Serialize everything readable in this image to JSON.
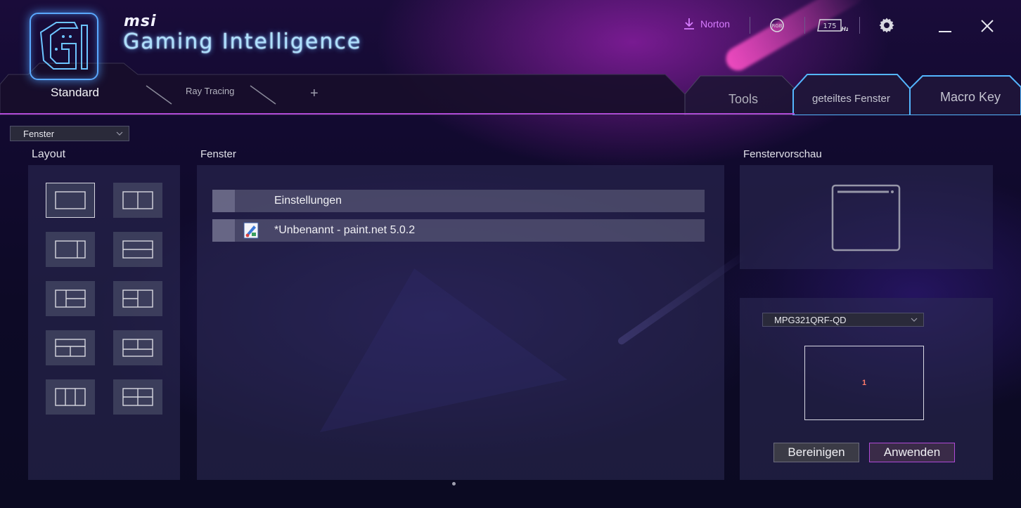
{
  "brand": {
    "vendor": "msi",
    "product": "Gaming Intelligence"
  },
  "header": {
    "norton_label": "Norton",
    "rgb_label": "RGB",
    "refresh_rate": "175",
    "refresh_unit": "Hz"
  },
  "tabs_left": [
    {
      "label": "Standard",
      "active": true
    },
    {
      "label": "Ray Tracing",
      "active": false
    },
    {
      "label": "+",
      "active": false
    }
  ],
  "tabs_right": [
    {
      "label": "Tools",
      "active": false
    },
    {
      "label": "geteiltes Fenster",
      "active": true
    },
    {
      "label": "Macro Key",
      "active": false
    }
  ],
  "mode_dropdown": {
    "value": "Fenster"
  },
  "sections": {
    "layout": "Layout",
    "windows": "Fenster",
    "preview": "Fenstervorschau"
  },
  "layouts": [
    {
      "id": "single",
      "selected": true
    },
    {
      "id": "two-columns",
      "selected": false
    },
    {
      "id": "wide-left-narrow-right",
      "selected": false
    },
    {
      "id": "two-rows",
      "selected": false
    },
    {
      "id": "left-column-plus-two-right",
      "selected": false
    },
    {
      "id": "two-columns-right-split",
      "selected": false
    },
    {
      "id": "top-row-plus-two-bottom",
      "selected": false
    },
    {
      "id": "two-top-plus-bottom-row",
      "selected": false
    },
    {
      "id": "three-columns",
      "selected": false
    },
    {
      "id": "four-quadrants",
      "selected": false
    }
  ],
  "windows": [
    {
      "title": "Einstellungen",
      "icon": "none"
    },
    {
      "title": "*Unbenannt - paint.net 5.0.2",
      "icon": "paint-net-icon"
    }
  ],
  "monitor_dropdown": {
    "value": "MPG321QRF-QD"
  },
  "monitor_map": {
    "zone_label": "1"
  },
  "buttons": {
    "clear": "Bereinigen",
    "apply": "Anwenden"
  },
  "colors": {
    "accent_purple": "#b04ad8",
    "accent_blue": "#5aa8ff",
    "norton": "#d77cff",
    "zone_number": "#ff7b6b"
  }
}
